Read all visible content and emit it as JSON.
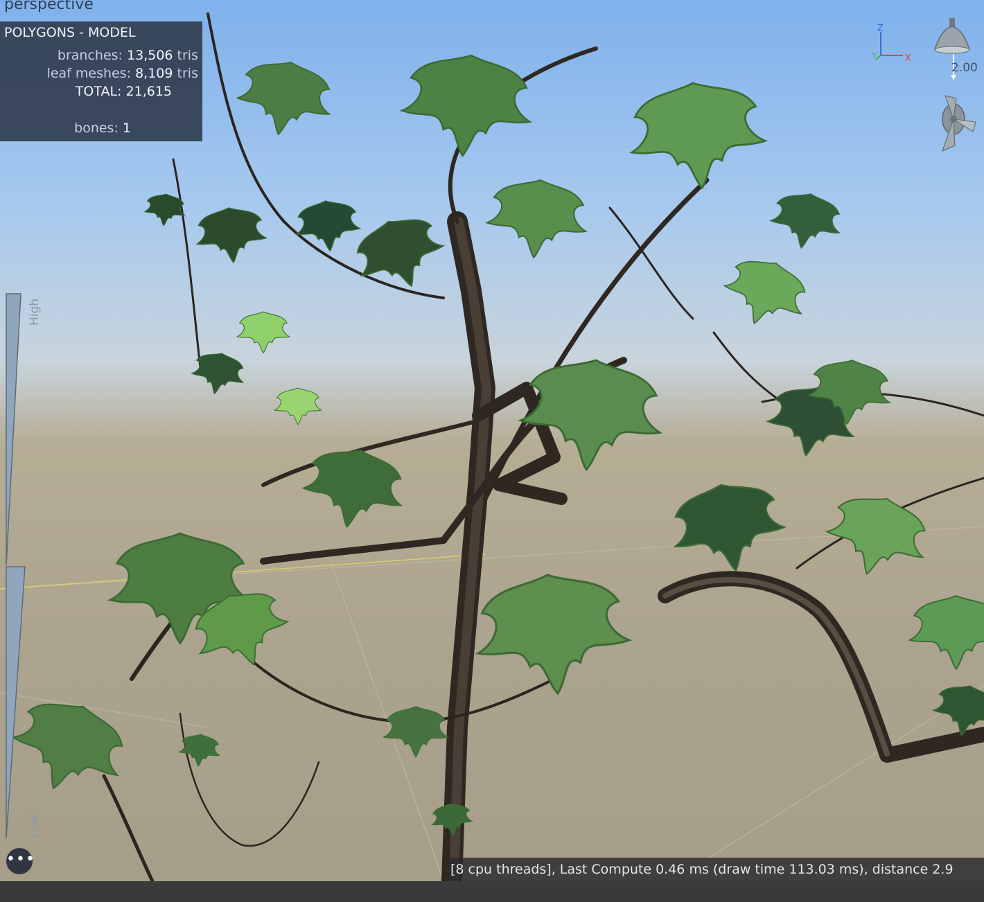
{
  "view": {
    "label": "perspective"
  },
  "stats": {
    "title": "POLYGONS - MODEL",
    "branches_label": "branches:",
    "branches_value": "13,506",
    "branches_unit": "tris",
    "leaves_label": "leaf meshes:",
    "leaves_value": "8,109",
    "leaves_unit": "tris",
    "total_label": "TOTAL:",
    "total_value": "21,615",
    "bones_label": "bones:",
    "bones_value": "1"
  },
  "lod": {
    "high_label": "High",
    "low_label": "Low"
  },
  "gizmo": {
    "z_label": "Z",
    "y_label": "Y",
    "x_label": "X"
  },
  "light": {
    "value": "2.00"
  },
  "menu": {
    "label": "•••"
  },
  "status": {
    "text": "[8 cpu threads], Last Compute 0.46 ms (draw time 113.03 ms), distance 2.9"
  },
  "colors": {
    "panel": "#344054",
    "sky": "#7fb1ec",
    "ground": "#ada48f",
    "leaf": "#5a8c4a",
    "bark": "#3a3129"
  }
}
